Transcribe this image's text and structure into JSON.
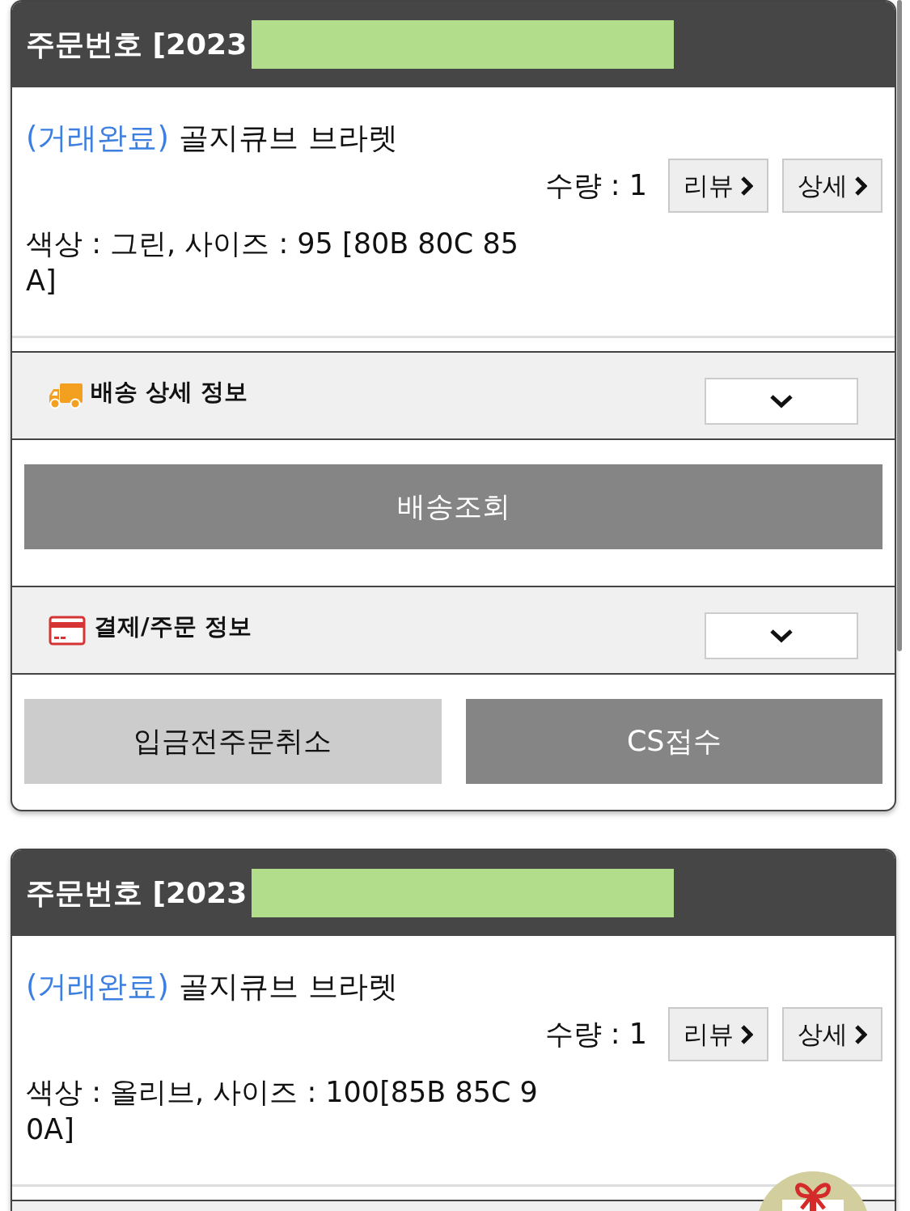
{
  "orders": [
    {
      "order_label": "주문번호 [2023",
      "redacted": true,
      "status": "(거래완료)",
      "product": "골지큐브 브라렛",
      "quantity": "수량 : 1",
      "actions": [
        {
          "label": "리뷰"
        },
        {
          "label": "상세"
        }
      ],
      "options": "색상 : 그린, 사이즈 : 95 [80B 80C 85A]",
      "sections": [
        {
          "kind": "delivery",
          "title": "배송 상세 정보",
          "expanded": false,
          "buttons": [
            {
              "label": "배송조회",
              "kind": "primary"
            }
          ]
        },
        {
          "kind": "payment",
          "title": "결제/주문 정보",
          "expanded": false,
          "buttons": [
            {
              "label": "입금전주문취소",
              "kind": "secondary"
            },
            {
              "label": "CS접수",
              "kind": "primary"
            }
          ]
        }
      ]
    },
    {
      "order_label": "주문번호 [2023",
      "redacted": true,
      "status": "(거래완료)",
      "product": "골지큐브 브라렛",
      "quantity": "수량 : 1",
      "actions": [
        {
          "label": "리뷰"
        },
        {
          "label": "상세"
        }
      ],
      "options": "색상 : 올리브, 사이즈 : 100[85B 85C 90A]",
      "section_below_cut": true
    }
  ],
  "floating_button": {
    "kind": "gift"
  }
}
